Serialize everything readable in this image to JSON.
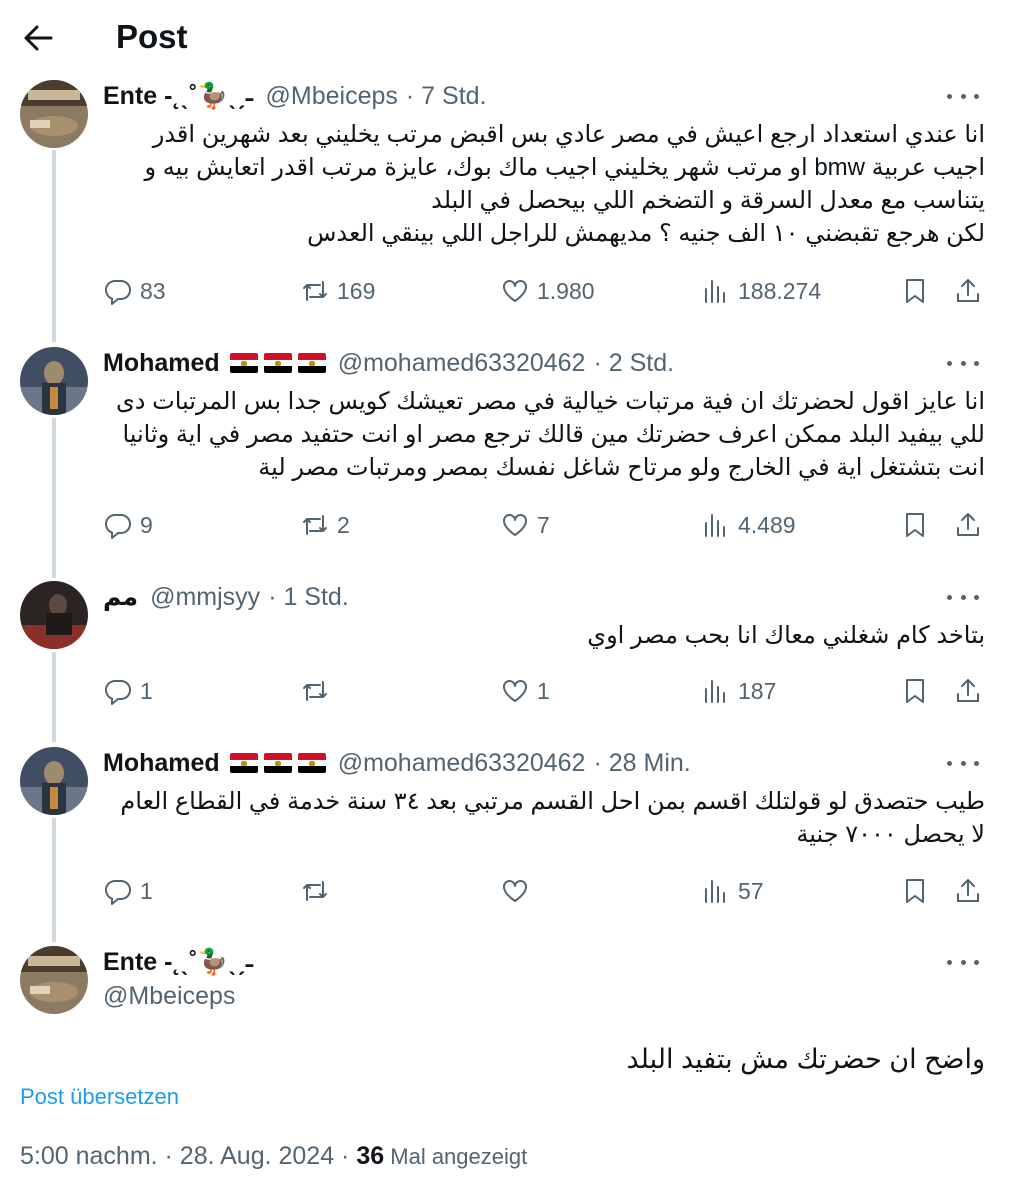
{
  "header": {
    "title": "Post",
    "back_icon": "arrow-left-icon"
  },
  "tweets": [
    {
      "name": "Ente -˛ˎ˚🦆ˎˏ˗",
      "handle": "@Mbeiceps",
      "time": "· 7 Std.",
      "text": "انا عندي استعداد ارجع اعيش في مصر عادي بس اقبض مرتب يخليني بعد شهرين اقدر اجيب عربية bmw او مرتب شهر يخليني اجيب ماك بوك، عايزة مرتب اقدر اتعايش بيه و يتناسب مع معدل السرقة و التضخم اللي بيحصل في البلد\nلكن هرجع تقبضني ١٠ الف جنيه ؟ مديهمش للراجل اللي بينقي العدس",
      "replies": "83",
      "retweets": "169",
      "likes": "1.980",
      "views": "188.274"
    },
    {
      "name": "Mohamed",
      "flags": [
        "egypt-flag",
        "egypt-flag",
        "egypt-flag"
      ],
      "handle": "@mohamed63320462",
      "time": "· 2 Std.",
      "text": "انا عايز اقول لحضرتك ان فية مرتبات خيالية في مصر تعيشك كويس جدا بس المرتبات دى للي بيفيد البلد ممكن اعرف حضرتك مين قالك ترجع مصر او انت حتفيد مصر في اية وثانيا انت بتشتغل اية في الخارج ولو مرتاح شاغل نفسك بمصر ومرتبات مصر لية",
      "replies": "9",
      "retweets": "2",
      "likes": "7",
      "views": "4.489"
    },
    {
      "name": "مم",
      "handle": "@mmjsyy",
      "time": "· 1 Std.",
      "text": "بتاخد كام شغلني معاك انا بحب مصر اوي",
      "replies": "1",
      "retweets": "",
      "likes": "1",
      "views": "187"
    },
    {
      "name": "Mohamed",
      "flags": [
        "egypt-flag",
        "egypt-flag",
        "egypt-flag"
      ],
      "handle": "@mohamed63320462",
      "time": "· 28 Min.",
      "text": "طيب حتصدق لو قولتلك اقسم بمن احل القسم مرتبي بعد ٣٤ سنة خدمة في القطاع العام لا يحصل ٧٠٠٠ جنية",
      "replies": "1",
      "retweets": "",
      "likes": "",
      "views": "57"
    }
  ],
  "main_tweet": {
    "name": "Ente -˛ˎ˚🦆ˎˏ˗",
    "handle": "@Mbeiceps",
    "text": "واضح ان حضرتك مش بتفيد البلد",
    "translate": "Post übersetzen",
    "meta_time": "5:00 nachm. · 28. Aug. 2024 · ",
    "views_count": "36",
    "views_label": " Mal angezeigt"
  },
  "colors": {
    "text": "#0f1419",
    "muted": "#536471",
    "link": "#1d9bf0",
    "thread_line": "#cfd9de"
  }
}
